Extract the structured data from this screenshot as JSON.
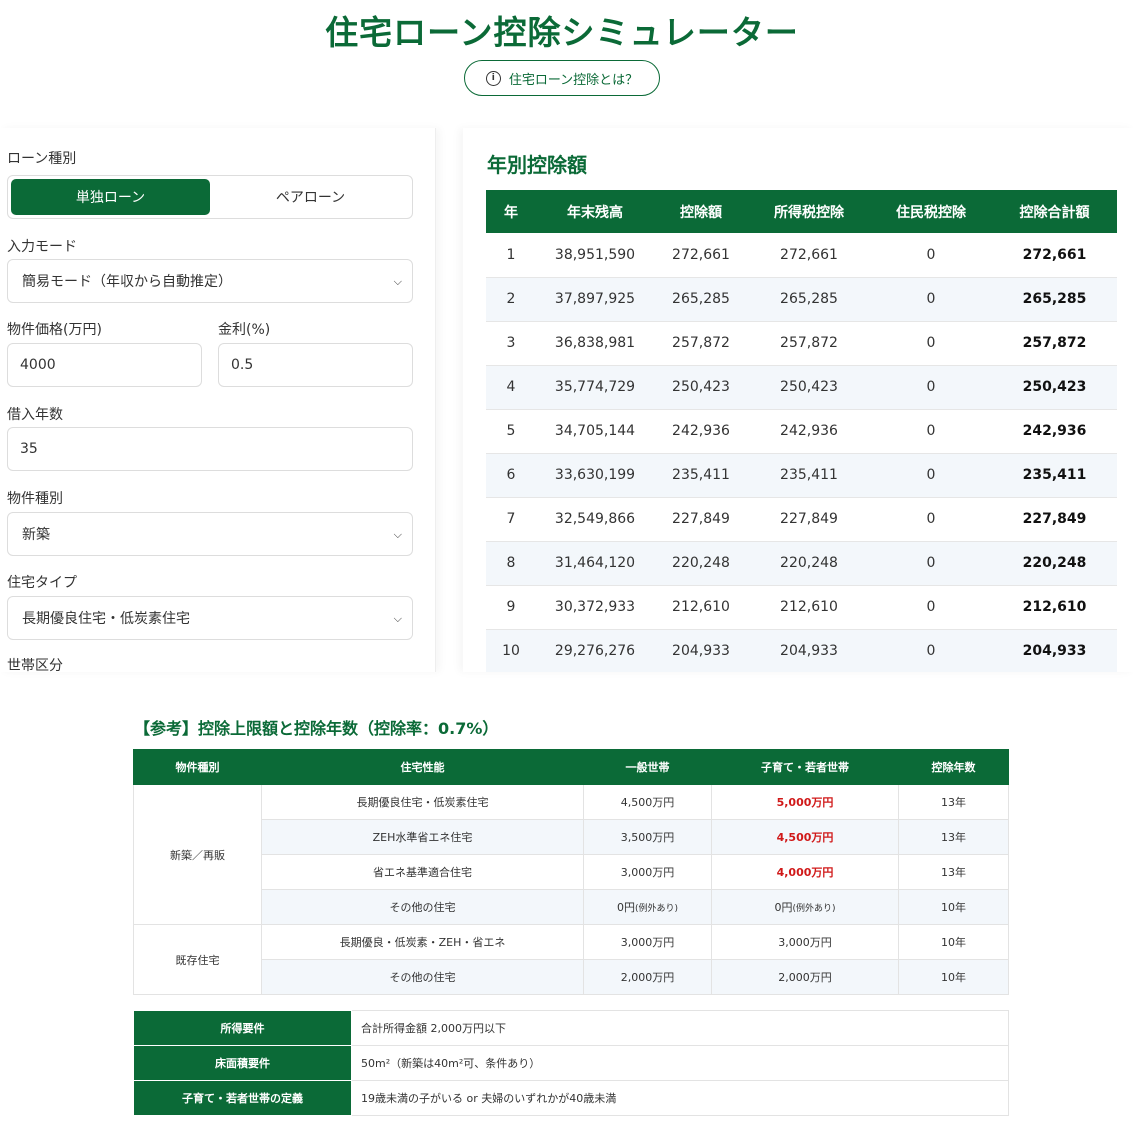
{
  "header": {
    "title": "住宅ローン控除シミュレーター",
    "about_button": "住宅ローン控除とは？"
  },
  "form": {
    "loan_type_label": "ローン種別",
    "loan_type_options": [
      "単独ローン",
      "ペアローン"
    ],
    "input_mode_label": "入力モード",
    "input_mode_value": "簡易モード（年収から自動推定）",
    "price_label": "物件価格(万円)",
    "price_value": "4000",
    "rate_label": "金利(%)",
    "rate_value": "0.5",
    "years_label": "借入年数",
    "years_value": "35",
    "property_kind_label": "物件種別",
    "property_kind_value": "新築",
    "house_type_label": "住宅タイプ",
    "house_type_value": "長期優良住宅・低炭素住宅",
    "household_label": "世帯区分"
  },
  "results": {
    "title": "年別控除額",
    "headers": [
      "年",
      "年末残高",
      "控除額",
      "所得税控除",
      "住民税控除",
      "控除合計額"
    ],
    "rows": [
      [
        "1",
        "38,951,590",
        "272,661",
        "272,661",
        "0",
        "272,661"
      ],
      [
        "2",
        "37,897,925",
        "265,285",
        "265,285",
        "0",
        "265,285"
      ],
      [
        "3",
        "36,838,981",
        "257,872",
        "257,872",
        "0",
        "257,872"
      ],
      [
        "4",
        "35,774,729",
        "250,423",
        "250,423",
        "0",
        "250,423"
      ],
      [
        "5",
        "34,705,144",
        "242,936",
        "242,936",
        "0",
        "242,936"
      ],
      [
        "6",
        "33,630,199",
        "235,411",
        "235,411",
        "0",
        "235,411"
      ],
      [
        "7",
        "32,549,866",
        "227,849",
        "227,849",
        "0",
        "227,849"
      ],
      [
        "8",
        "31,464,120",
        "220,248",
        "220,248",
        "0",
        "220,248"
      ],
      [
        "9",
        "30,372,933",
        "212,610",
        "212,610",
        "0",
        "212,610"
      ],
      [
        "10",
        "29,276,276",
        "204,933",
        "204,933",
        "0",
        "204,933"
      ]
    ]
  },
  "reference": {
    "title": "【参考】控除上限額と控除年数（控除率：0.7%）",
    "headers": [
      "物件種別",
      "住宅性能",
      "一般世帯",
      "子育て・若者世帯",
      "控除年数"
    ],
    "new_group": "新築／再販",
    "existing_group": "既存住宅",
    "note": "(例外あり)",
    "rows": [
      [
        "長期優良住宅・低炭素住宅",
        "4,500万円",
        "5,000万円",
        "13年"
      ],
      [
        "ZEH水準省エネ住宅",
        "3,500万円",
        "4,500万円",
        "13年"
      ],
      [
        "省エネ基準適合住宅",
        "3,000万円",
        "4,000万円",
        "13年"
      ],
      [
        "その他の住宅",
        "0円",
        "0円",
        "10年"
      ],
      [
        "長期優良・低炭素・ZEH・省エネ",
        "3,000万円",
        "3,000万円",
        "10年"
      ],
      [
        "その他の住宅",
        "2,000万円",
        "2,000万円",
        "10年"
      ]
    ],
    "requirements": [
      {
        "label": "所得要件",
        "value": "合計所得金額 2,000万円以下"
      },
      {
        "label": "床面積要件",
        "value": "50m²（新築は40m²可、条件あり）"
      },
      {
        "label": "子育て・若者世帯の定義",
        "value": "19歳未満の子がいる or 夫婦のいずれかが40歳未満"
      }
    ]
  }
}
